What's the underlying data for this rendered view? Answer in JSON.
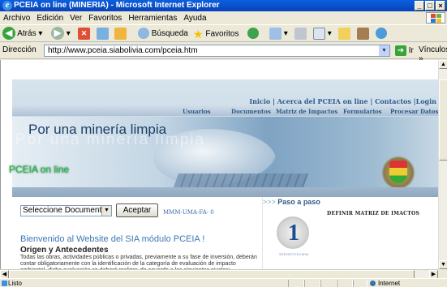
{
  "window": {
    "title": "PCEIA on line (MINERIA) - Microsoft Internet Explorer",
    "minimize": "_",
    "maximize": "□",
    "close": "×"
  },
  "menu": [
    "Archivo",
    "Edición",
    "Ver",
    "Favoritos",
    "Herramientas",
    "Ayuda"
  ],
  "toolbar": {
    "back": "Atrás",
    "search": "Búsqueda",
    "favorites": "Favoritos"
  },
  "address": {
    "label": "Dirección",
    "url": "http://www.pceia.siabolivia.com/pceia.htm",
    "go": "Ir",
    "links": "Vínculos"
  },
  "page": {
    "toplinks": [
      "Inicio",
      "Acerca del PCEIA on line",
      "Contactos",
      "Login"
    ],
    "nav": [
      "Usuarios",
      "Documentos",
      "Matriz de Impactos",
      "Formularios",
      "Procesar Datos"
    ],
    "banner_title": "Por una minería limpia",
    "banner_ghost": "Por una minería limpia",
    "banner_sub": "PCEIA on line",
    "doc_select": "Seleccione Documento",
    "accept": "Aceptar",
    "doc_code": "MMM-UMA-FA- 0",
    "welcome": "Bienvenido al Website del SIA módulo PCEIA !",
    "origin_title": "Origen y Antecedentes",
    "origin_text": "Todas las obras, actividades públicas o privadas, previamente a su fase de inversión, deberán contar obligatoriamente con la identificación de la categoría de evaluación de impacto ambiental, dicha evaluación se deberá realizar, de acuerdo a los siguientes niveles:",
    "paso_chevrons": ">>>",
    "paso": "Paso a paso",
    "definir": "DEFINIR MATRIZ DE IMACTOS",
    "badge_number": "1",
    "badge_caption": "SERGEOTECMIN"
  },
  "status": {
    "text": "Listo",
    "zone": "Internet"
  }
}
